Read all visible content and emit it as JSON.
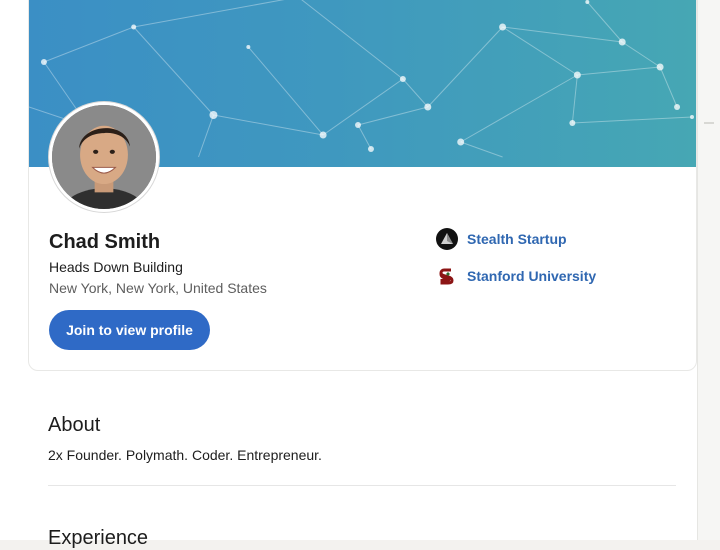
{
  "profile": {
    "name": "Chad Smith",
    "headline": "Heads Down Building",
    "location": "New York, New York, United States",
    "join_label": "Join to view profile"
  },
  "companies": [
    {
      "name": "Stealth Startup",
      "icon": "stealth-startup-logo"
    },
    {
      "name": "Stanford University",
      "icon": "stanford-logo"
    }
  ],
  "about": {
    "title": "About",
    "text": "2x Founder. Polymath. Coder. Entrepreneur."
  },
  "experience": {
    "title": "Experience"
  },
  "colors": {
    "primary_button": "#2f6ac6",
    "link": "#2f67b1",
    "banner_start": "#3b8fc5",
    "banner_end": "#46a7b4"
  }
}
